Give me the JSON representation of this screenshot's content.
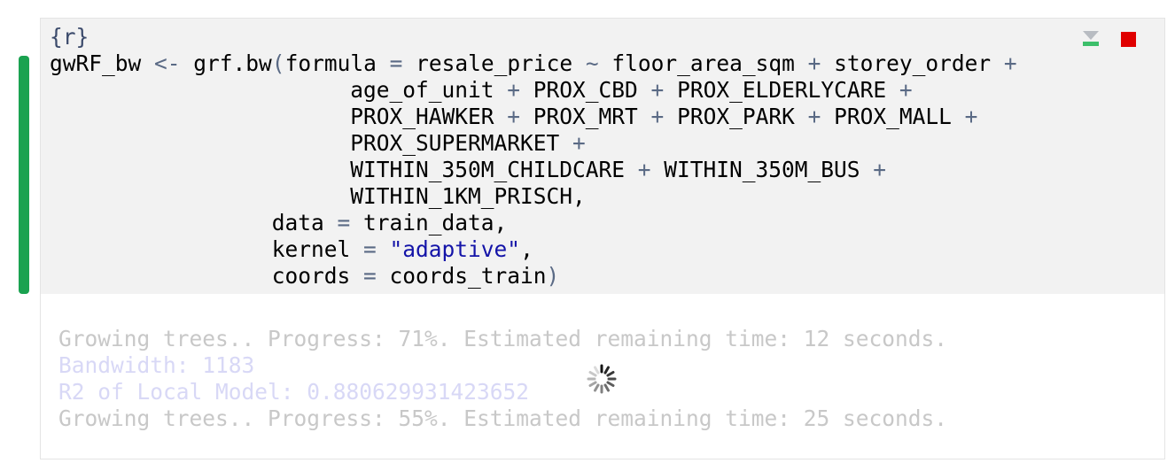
{
  "chunk": {
    "header": "{r}",
    "code_lines": [
      [
        {
          "t": "gwRF_bw ",
          "c": ""
        },
        {
          "t": "<-",
          "c": "op"
        },
        {
          "t": " grf.bw",
          "c": ""
        },
        {
          "t": "(",
          "c": "op"
        },
        {
          "t": "formula ",
          "c": ""
        },
        {
          "t": "=",
          "c": "op"
        },
        {
          "t": " resale_price ",
          "c": ""
        },
        {
          "t": "~",
          "c": "op"
        },
        {
          "t": " floor_area_sqm ",
          "c": ""
        },
        {
          "t": "+",
          "c": "op"
        },
        {
          "t": " storey_order ",
          "c": ""
        },
        {
          "t": "+",
          "c": "op"
        }
      ],
      [
        {
          "t": "                       age_of_unit ",
          "c": ""
        },
        {
          "t": "+",
          "c": "op"
        },
        {
          "t": " PROX_CBD ",
          "c": ""
        },
        {
          "t": "+",
          "c": "op"
        },
        {
          "t": " PROX_ELDERLYCARE ",
          "c": ""
        },
        {
          "t": "+",
          "c": "op"
        }
      ],
      [
        {
          "t": "                       PROX_HAWKER ",
          "c": ""
        },
        {
          "t": "+",
          "c": "op"
        },
        {
          "t": " PROX_MRT ",
          "c": ""
        },
        {
          "t": "+",
          "c": "op"
        },
        {
          "t": " PROX_PARK ",
          "c": ""
        },
        {
          "t": "+",
          "c": "op"
        },
        {
          "t": " PROX_MALL ",
          "c": ""
        },
        {
          "t": "+",
          "c": "op"
        }
      ],
      [
        {
          "t": "                       PROX_SUPERMARKET ",
          "c": ""
        },
        {
          "t": "+",
          "c": "op"
        }
      ],
      [
        {
          "t": "                       WITHIN_350M_CHILDCARE ",
          "c": ""
        },
        {
          "t": "+",
          "c": "op"
        },
        {
          "t": " WITHIN_350M_BUS ",
          "c": ""
        },
        {
          "t": "+",
          "c": "op"
        }
      ],
      [
        {
          "t": "                       WITHIN_1KM_PRISCH,",
          "c": ""
        }
      ],
      [
        {
          "t": "                 data ",
          "c": ""
        },
        {
          "t": "=",
          "c": "op"
        },
        {
          "t": " train_data,",
          "c": ""
        }
      ],
      [
        {
          "t": "                 kernel ",
          "c": ""
        },
        {
          "t": "=",
          "c": "op"
        },
        {
          "t": " ",
          "c": ""
        },
        {
          "t": "\"adaptive\"",
          "c": "str"
        },
        {
          "t": ",",
          "c": ""
        }
      ],
      [
        {
          "t": "                 coords ",
          "c": ""
        },
        {
          "t": "=",
          "c": "op"
        },
        {
          "t": " coords_train",
          "c": ""
        },
        {
          "t": ")",
          "c": "op"
        }
      ]
    ],
    "icons": {
      "run_below": "run-all-below-icon",
      "stop": "stop-icon"
    }
  },
  "output": {
    "lines": [
      {
        "text": "Growing trees.. Progress: 71%. Estimated remaining time: 12 seconds.",
        "style": "gray"
      },
      {
        "text": "Bandwidth: 1183",
        "style": "lav"
      },
      {
        "text": "R2 of Local Model: 0.880629931423652",
        "style": "lav"
      },
      {
        "text": "Growing trees.. Progress: 55%. Estimated remaining time: 25 seconds.",
        "style": "gray"
      }
    ]
  },
  "colors": {
    "running_bar": "#1aa250",
    "stop": "#e00000",
    "string": "#1414a8"
  }
}
